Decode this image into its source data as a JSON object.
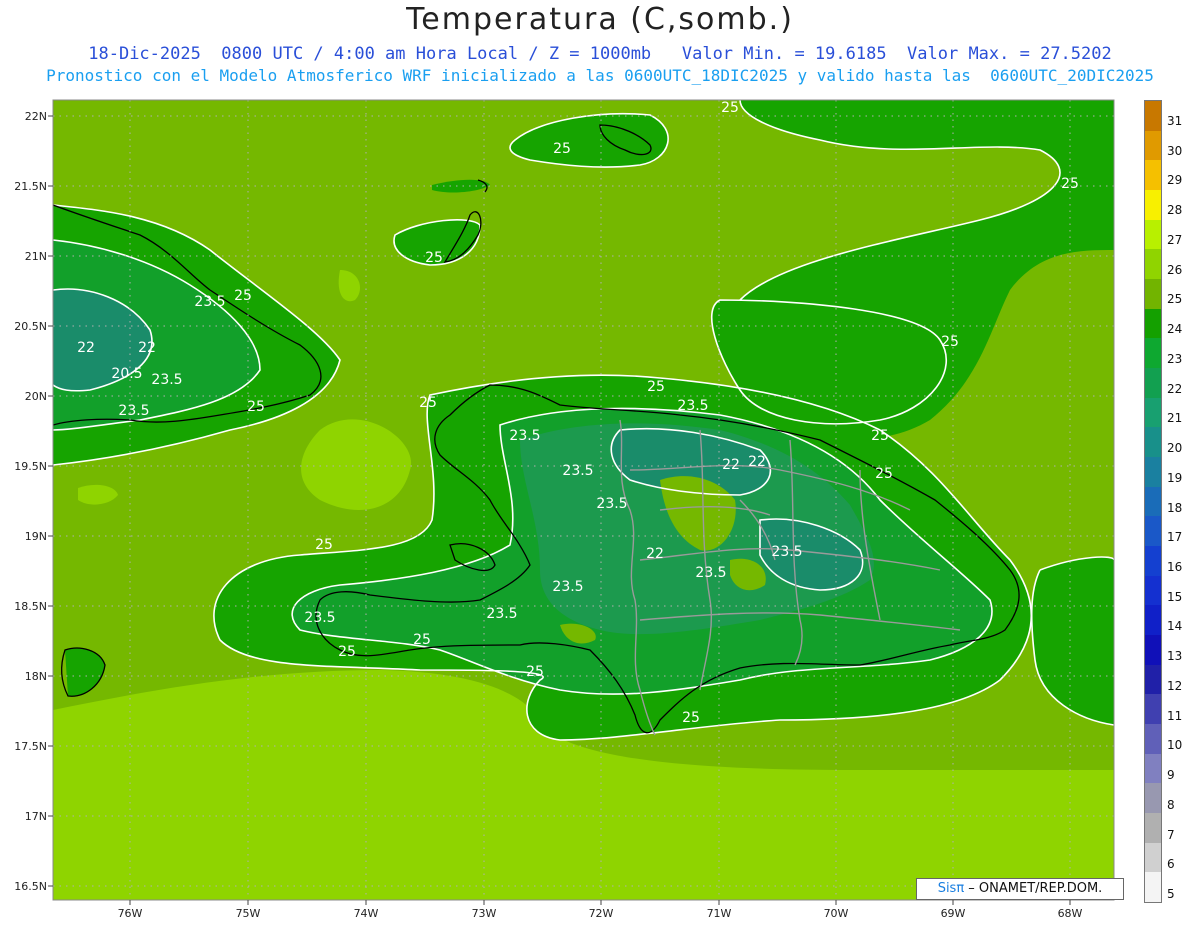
{
  "header": {
    "title": "Temperatura (C,somb.)",
    "subtitle1": "18-Dic-2025  0800 UTC / 4:00 am Hora Local / Z = 1000mb   Valor Min. = 19.6185  Valor Max. = 27.5202",
    "subtitle2": "Pronostico con el Modelo Atmosferico WRF inicializado a las 0600UTC_18DIC2025 y valido hasta las  0600UTC_20DIC2025"
  },
  "map": {
    "lat_labels": [
      "22N",
      "21.5N",
      "21N",
      "20.5N",
      "20N",
      "19.5N",
      "19N",
      "18.5N",
      "18N",
      "17.5N",
      "17N",
      "16.5N"
    ],
    "lon_labels": [
      "76W",
      "75W",
      "74W",
      "73W",
      "72W",
      "71W",
      "70W",
      "69W",
      "68W"
    ],
    "contour_labels": [
      "25",
      "25",
      "25",
      "25",
      "25",
      "25",
      "25",
      "25",
      "25",
      "25",
      "25",
      "25",
      "25",
      "25",
      "25",
      "25",
      "23.5",
      "23.5",
      "23.5",
      "23.5",
      "23.5",
      "23.5",
      "23.5",
      "23.5",
      "23.5",
      "23.5",
      "23.5",
      "23.5",
      "22",
      "22",
      "22",
      "22",
      "22",
      "20.5"
    ],
    "colors": {
      "t27": "#8fd400",
      "t26": "#75b800",
      "t25": "#16a400",
      "t24": "#12a02a",
      "t23": "#1c9a4e",
      "t22": "#1a8c6a",
      "contour": "#ffffff",
      "coast": "#000000",
      "border": "#9a9a9a"
    }
  },
  "colorbar": {
    "labels": [
      "31",
      "30",
      "29",
      "28",
      "27",
      "26",
      "25",
      "24",
      "23",
      "22",
      "21",
      "20",
      "19",
      "18",
      "17",
      "16",
      "15",
      "14",
      "13",
      "12",
      "11",
      "10",
      "9",
      "8",
      "7",
      "6",
      "5"
    ],
    "colors": [
      "#c87800",
      "#e09a00",
      "#f5c000",
      "#f8f000",
      "#b8f000",
      "#90d400",
      "#72b400",
      "#14a000",
      "#0ea830",
      "#12a050",
      "#18a070",
      "#18908a",
      "#1a80a0",
      "#1a6cb8",
      "#1a58c8",
      "#1440d0",
      "#1430d0",
      "#1020c8",
      "#1010b8",
      "#2020a8",
      "#4040b0",
      "#6060b8",
      "#8080c0",
      "#9898b0",
      "#b0b0b0",
      "#d0d0d0",
      "#f4f4f4"
    ]
  },
  "credit": {
    "brand": "Sisπ",
    "text": " – ONAMET/REP.DOM."
  }
}
